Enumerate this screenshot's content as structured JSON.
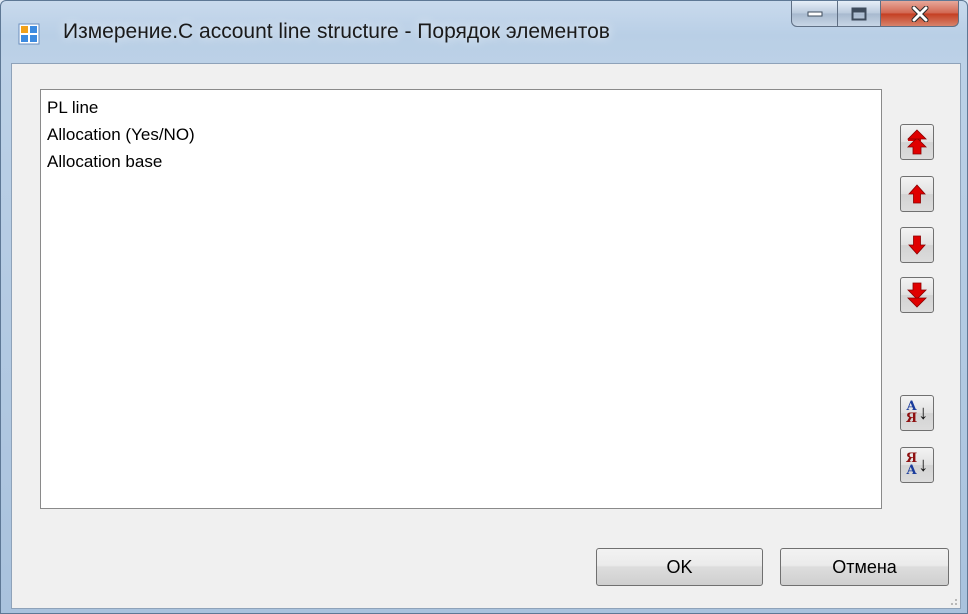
{
  "window": {
    "title": "Измерение.C account line structure - Порядок элементов",
    "icon": "form-app-icon",
    "caption_buttons": [
      "minimize-icon",
      "maximize-icon",
      "close-icon"
    ]
  },
  "list": {
    "items": [
      {
        "label": "PL line"
      },
      {
        "label": "Allocation (Yes/NO)"
      },
      {
        "label": "Allocation base"
      }
    ]
  },
  "side_buttons": {
    "move_top": {
      "icon": "double-arrow-up-icon"
    },
    "move_up": {
      "icon": "arrow-up-icon"
    },
    "move_down": {
      "icon": "arrow-down-icon"
    },
    "move_bottom": {
      "icon": "double-arrow-down-icon"
    },
    "sort_asc": {
      "icon": "sort-ascending-icon",
      "letters": [
        "А",
        "Я"
      ]
    },
    "sort_desc": {
      "icon": "sort-descending-icon",
      "letters": [
        "Я",
        "А"
      ]
    }
  },
  "footer": {
    "ok_label": "OK",
    "cancel_label": "Отмена"
  },
  "colors": {
    "arrow_red": "#e00000",
    "arrow_dark_red": "#8a0000"
  }
}
